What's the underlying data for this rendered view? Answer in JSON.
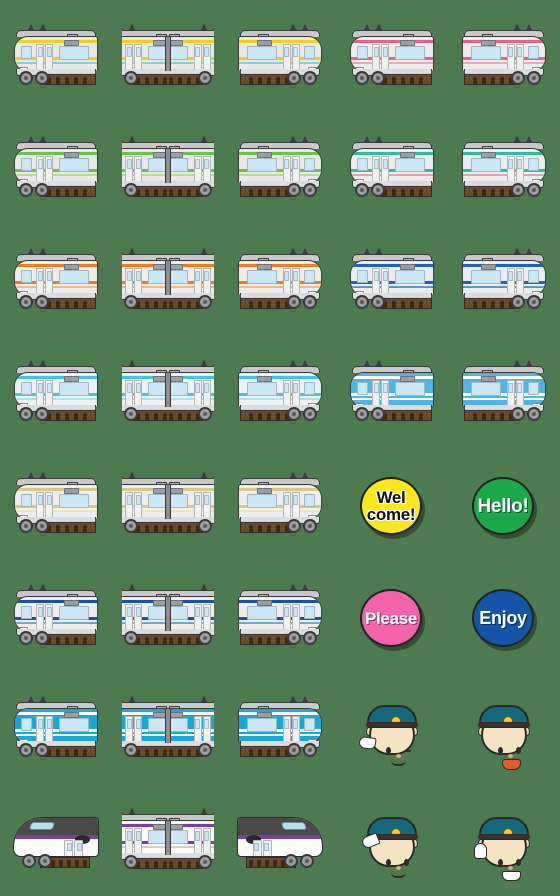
{
  "sheet": {
    "title": "Train Emoji Sticker Sheet",
    "background_color": "#4d7a50",
    "columns": 5,
    "rows": 8,
    "total_items": 40
  },
  "palette": {
    "body_light_gray": "#e8e8e8",
    "roof_gray": "#c9c9c9",
    "outline": "#3a3a3a",
    "window_blue": "#cbe7f5",
    "track_brown": "#6b4a2b",
    "tie_dark": "#3e2a18"
  },
  "rows": [
    {
      "index": 1,
      "left_line_name": "yellow-stripe-commuter",
      "left_stripe_color": "#f2d019",
      "left_stripe_accent": "#7fd4d4",
      "left_body_color": "#e8e8e8",
      "right_line_name": "pink-stripe-commuter",
      "right_stripe_color": "#e8608f",
      "right_stripe_accent": "#f0a8b8",
      "right_body_color": "#ededed"
    },
    {
      "index": 2,
      "left_line_name": "green-stripe-commuter",
      "left_stripe_color": "#6cc24a",
      "left_stripe_accent": "#b8e08c",
      "left_body_color": "#e8e8e8",
      "right_line_name": "teal-stripe-commuter",
      "right_stripe_color": "#2bbfa0",
      "right_stripe_accent": "#e8a0b0",
      "right_body_color": "#ededed"
    },
    {
      "index": 3,
      "left_line_name": "orange-stripe-commuter",
      "left_stripe_color": "#f07c1e",
      "left_stripe_accent": "#f9bb7a",
      "left_body_color": "#ededed",
      "right_line_name": "blue-stripe-commuter",
      "right_stripe_color": "#1f62c4",
      "right_stripe_accent": "#4f9be0",
      "right_body_color": "#ededed"
    },
    {
      "index": 4,
      "left_line_name": "cyan-stripe-commuter",
      "left_stripe_color": "#3fc8e0",
      "left_stripe_accent": "#a9e6f2",
      "left_body_color": "#eef2f3",
      "right_line_name": "sky-blue-body-train",
      "right_stripe_color": "#ffffff",
      "right_stripe_accent": "#ffffff",
      "right_body_color": "#4fb4e8"
    },
    {
      "index": 5,
      "left_line_name": "cream-stripe-commuter",
      "left_stripe_color": "#d8c98a",
      "left_stripe_accent": "#efe4b8",
      "left_body_color": "#eeeeee",
      "right_line_name": "text-badges",
      "right_stripe_color": "#000000",
      "right_stripe_accent": "#000000",
      "right_body_color": "#000000"
    },
    {
      "index": 6,
      "left_line_name": "navy-stripe-commuter",
      "left_stripe_color": "#1d4fa8",
      "left_stripe_accent": "#6fa8dd",
      "left_body_color": "#eeeeee",
      "right_line_name": "text-badges",
      "right_stripe_color": "#000000",
      "right_stripe_accent": "#000000",
      "right_body_color": "#000000"
    },
    {
      "index": 7,
      "left_line_name": "cyan-body-train",
      "left_stripe_color": "#ffffff",
      "left_stripe_accent": "#ffffff",
      "left_body_color": "#18a8dc",
      "right_line_name": "conductor-faces",
      "right_stripe_color": "#000000",
      "right_stripe_accent": "#000000",
      "right_body_color": "#000000"
    },
    {
      "index": 8,
      "left_line_name": "purple-shinkansen",
      "left_stripe_color": "#7b3fa0",
      "left_stripe_accent": "#4a4a4a",
      "left_body_color": "#fbfbfb",
      "right_line_name": "conductor-faces",
      "right_stripe_color": "#000000",
      "right_stripe_accent": "#000000",
      "right_body_color": "#000000"
    }
  ],
  "badges": [
    {
      "name": "welcome-badge",
      "line1": "Wel",
      "line2": "come!",
      "fill": "#f8e81c",
      "text_color": "#111111",
      "text_style": "dark",
      "font_size": "17px"
    },
    {
      "name": "hello-badge",
      "line1": "Hello!",
      "line2": "",
      "fill": "#1aa84a",
      "text_color": "#ffffff",
      "text_style": "light",
      "font_size": "19px"
    },
    {
      "name": "please-badge",
      "line1": "Please",
      "line2": "",
      "fill": "#f263ab",
      "text_color": "#ffffff",
      "text_style": "light",
      "font_size": "17px"
    },
    {
      "name": "enjoy-badge",
      "line1": "Enjoy",
      "line2": "",
      "fill": "#1455a8",
      "text_color": "#ffffff",
      "text_style": "light",
      "font_size": "18px"
    }
  ],
  "conductors": [
    {
      "name": "conductor-winking-waving",
      "expression": "wink",
      "gesture": "glove-low",
      "cap_color": "#14697a",
      "emblem_color": "#f2c42c",
      "skin_color": "#f7e3c6"
    },
    {
      "name": "conductor-announcing",
      "expression": "open-mouth",
      "gesture": "none",
      "cap_color": "#14697a",
      "emblem_color": "#f2c42c",
      "skin_color": "#f7e3c6"
    },
    {
      "name": "conductor-saluting",
      "expression": "smile",
      "gesture": "glove-salute",
      "cap_color": "#14697a",
      "emblem_color": "#f2c42c",
      "skin_color": "#f7e3c6"
    },
    {
      "name": "conductor-pointing",
      "expression": "teeth",
      "gesture": "glove-point",
      "cap_color": "#14697a",
      "emblem_color": "#f2c42c",
      "skin_color": "#f7e3c6"
    }
  ],
  "column_variants": [
    {
      "index": 1,
      "label": "left-facing cab car"
    },
    {
      "index": 2,
      "label": "coupled middle cars"
    },
    {
      "index": 3,
      "label": "right-facing cab car"
    },
    {
      "index": 4,
      "label": "alternate line left-facing cab car"
    },
    {
      "index": 5,
      "label": "alternate line right-facing cab car"
    }
  ]
}
